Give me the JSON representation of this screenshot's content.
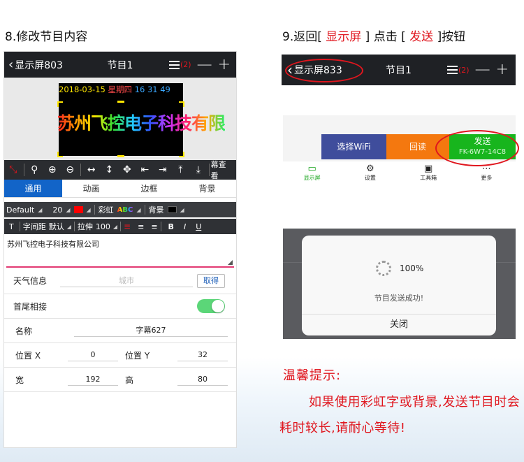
{
  "step8": {
    "number": "8.",
    "title": "修改节目内容"
  },
  "step9": {
    "prefix": "9.返回[",
    "screen": " 显示屏 ",
    "mid": "] 点击 [",
    "send": " 发送 ",
    "suffix": "]按钮"
  },
  "phone1": {
    "nav": {
      "back": "显示屏803",
      "title": "节目1",
      "badge": "(2)",
      "minus": "—",
      "plus": "+"
    },
    "preview": {
      "date": "2018-03-15",
      "weekday": "星期四",
      "time": "16 31 49",
      "scroll_text": "苏州飞控电子科技有限"
    },
    "toolbar": {
      "screen_view": "幕查看"
    },
    "tabs": [
      {
        "label": "通用",
        "active": true
      },
      {
        "label": "动画"
      },
      {
        "label": "边框"
      },
      {
        "label": "背景"
      }
    ],
    "fontbar": {
      "font": "Default",
      "size": "20",
      "rainbow": "彩虹",
      "rainbow_sample": "ABC",
      "background": "背景",
      "text_color": "#ff0000",
      "bg_color": "#000000"
    },
    "formatbar": {
      "t": "T",
      "spacing": "字间距",
      "spacing_value": "默认",
      "stretch": "拉伸",
      "stretch_value": "100",
      "bold": "B",
      "italic": "I",
      "underline": "U"
    },
    "content": "苏州飞控电子科技有限公司",
    "weather": {
      "label": "天气信息",
      "placeholder": "城市",
      "button": "取得"
    },
    "loop": {
      "label": "首尾相接",
      "on": true
    },
    "name": {
      "label": "名称",
      "value": "字幕627"
    },
    "position": {
      "x_label": "位置 X",
      "x_value": "0",
      "y_label": "位置 Y",
      "y_value": "32"
    },
    "size": {
      "w_label": "宽",
      "w_value": "192",
      "h_label": "高",
      "h_value": "80"
    }
  },
  "phone2": {
    "nav": {
      "back": "显示屏833",
      "title": "节目1",
      "badge": "(2)",
      "minus": "—",
      "plus": "+"
    },
    "buttons": {
      "wifi": "选择WiFi",
      "read": "回读",
      "send": "发送",
      "send_id": "FK-6W7-14C8"
    },
    "bottom_nav": [
      {
        "label": "显示屏",
        "icon": "monitor-icon"
      },
      {
        "label": "设置",
        "icon": "gear-icon"
      },
      {
        "label": "工具箱",
        "icon": "toolbox-icon"
      },
      {
        "label": "更多",
        "icon": "more-icon"
      }
    ],
    "dialog": {
      "percent": "100%",
      "message": "节目发送成功!",
      "close": "关闭"
    }
  },
  "tip": {
    "title": "温馨提示:",
    "body": "如果使用彩虹字或背景,发送节目时会耗时较长,请耐心等待!"
  },
  "colors": {
    "accent_red": "#e0161e",
    "tab_blue": "#1264c8",
    "send_green": "#17b51d",
    "read_orange": "#f4780f",
    "wifi_indigo": "#3f4d9c"
  }
}
